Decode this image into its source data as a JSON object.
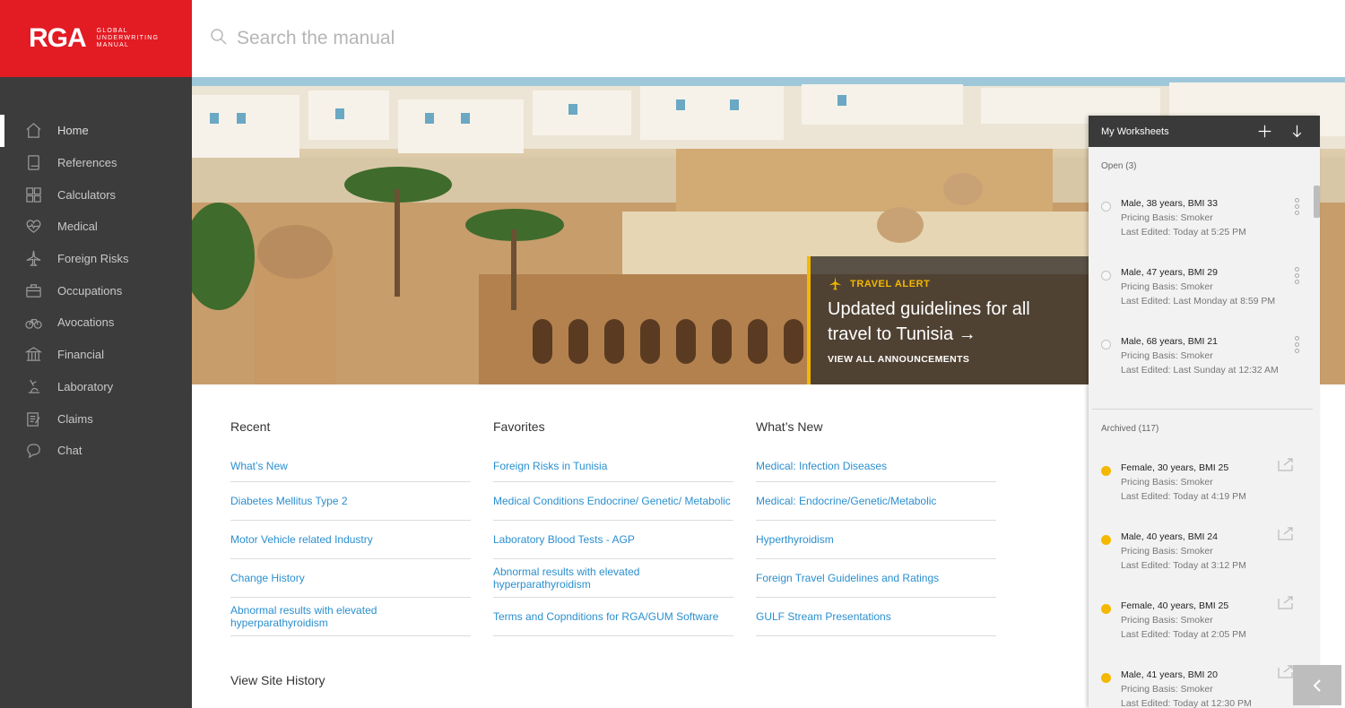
{
  "brand": {
    "logo": "RGA",
    "tagline": "GLOBAL UNDERWRITING MANUAL",
    "color": "#e31b23"
  },
  "search": {
    "placeholder": "Search the manual"
  },
  "sidebar": {
    "items": [
      {
        "label": "Home",
        "icon": "home-icon",
        "active": true
      },
      {
        "label": "References",
        "icon": "book-icon"
      },
      {
        "label": "Calculators",
        "icon": "calculator-icon"
      },
      {
        "label": "Medical",
        "icon": "heart-icon"
      },
      {
        "label": "Foreign Risks",
        "icon": "airplane-icon"
      },
      {
        "label": "Occupations",
        "icon": "briefcase-icon"
      },
      {
        "label": "Avocations",
        "icon": "bicycle-icon"
      },
      {
        "label": "Financial",
        "icon": "bank-icon"
      },
      {
        "label": "Laboratory",
        "icon": "lab-icon"
      },
      {
        "label": "Claims",
        "icon": "clipboard-icon"
      },
      {
        "label": "Chat",
        "icon": "chat-bubble-icon"
      }
    ]
  },
  "hero": {
    "alert_label": "TRAVEL ALERT",
    "alert_title": "Updated guidelines for all travel to Tunisia →",
    "alert_link": "VIEW ALL ANNOUNCEMENTS",
    "accent": "#f5b800"
  },
  "columns": {
    "recent": {
      "title": "Recent",
      "links": [
        "What’s New",
        "Diabetes Mellitus Type 2",
        "Motor Vehicle related Industry",
        "Change History",
        "Abnormal results with elevated hyperparathyroidism"
      ]
    },
    "favorites": {
      "title": "Favorites",
      "links": [
        "Foreign Risks in Tunisia",
        "Medical Conditions Endocrine/ Genetic/ Metabolic",
        "Laboratory Blood Tests - AGP",
        "Abnormal results with elevated hyperparathyroidism",
        "Terms and Copnditions for RGA/GUM Software"
      ]
    },
    "whats_new": {
      "title": "What’s New",
      "links": [
        "Medical: Infection Diseases",
        "Medical: Endocrine/Genetic/Metabolic",
        "Hyperthyroidism",
        "Foreign Travel Guidelines and Ratings",
        "GULF Stream Presentations"
      ]
    }
  },
  "history": {
    "title": "View Site History"
  },
  "worksheets": {
    "title": "My Worksheets",
    "open_label": "Open (3)",
    "archived_label": "Archived (117)",
    "open": [
      {
        "title": "Male, 38 years, BMI 33",
        "basis": "Pricing Basis: Smoker",
        "edited": "Last Edited: Today at 5:25 PM"
      },
      {
        "title": "Male, 47 years, BMI 29",
        "basis": "Pricing Basis: Smoker",
        "edited": "Last Edited: Last Monday at 8:59 PM"
      },
      {
        "title": "Male, 68 years, BMI 21",
        "basis": "Pricing Basis: Smoker",
        "edited": "Last Edited: Last Sunday at 12:32 AM"
      }
    ],
    "archived": [
      {
        "title": "Female, 30 years, BMI 25",
        "basis": "Pricing Basis: Smoker",
        "edited": "Last Edited: Today at 4:19 PM"
      },
      {
        "title": "Male, 40 years, BMI 24",
        "basis": "Pricing Basis: Smoker",
        "edited": "Last Edited: Today at 3:12 PM"
      },
      {
        "title": "Female, 40 years, BMI 25",
        "basis": "Pricing Basis: Smoker",
        "edited": "Last Edited: Today at 2:05 PM"
      },
      {
        "title": "Male, 41 years, BMI 20",
        "basis": "Pricing Basis: Smoker",
        "edited": "Last Edited: Today at 12:30 PM"
      }
    ],
    "archived_dot_color": "#f5b800"
  }
}
